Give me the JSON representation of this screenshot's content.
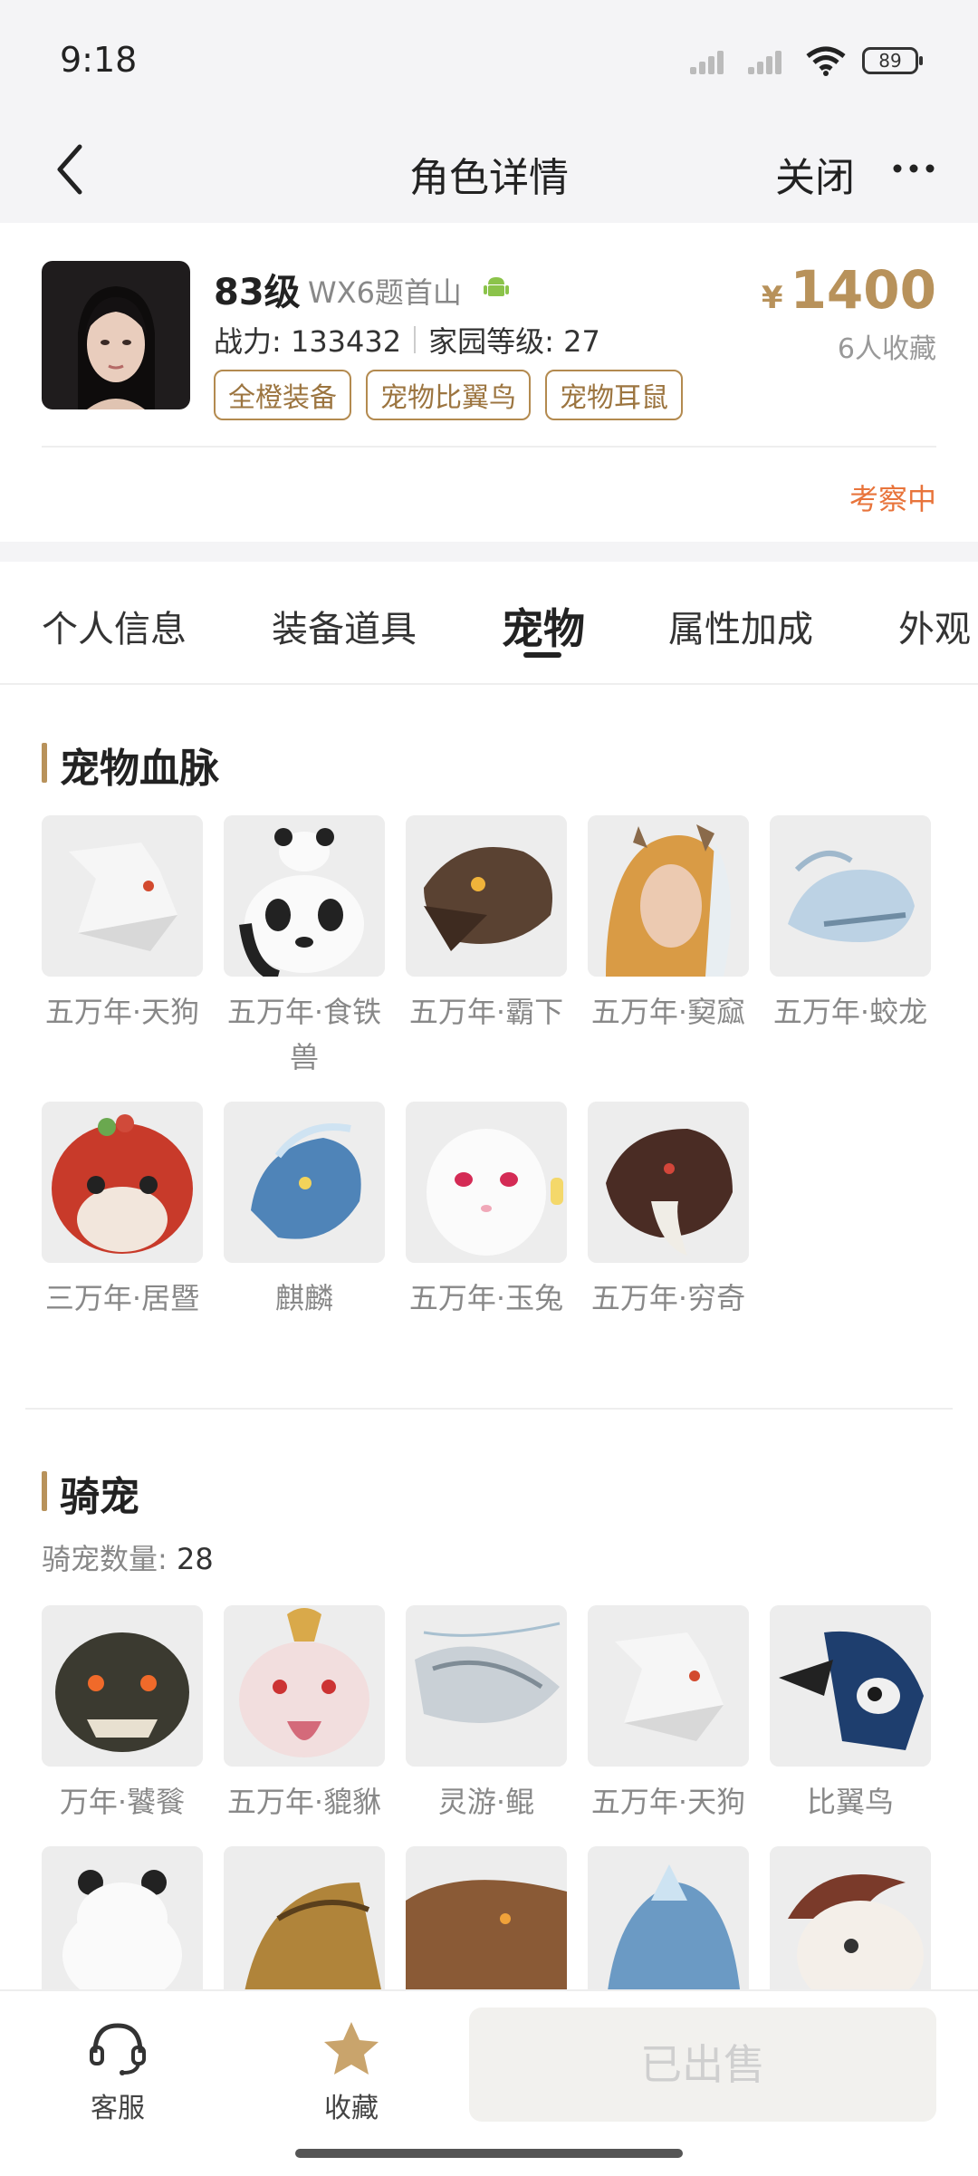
{
  "status_bar": {
    "time": "9:18",
    "battery": "89"
  },
  "nav": {
    "title": "角色详情",
    "close_label": "关闭"
  },
  "character": {
    "level": "83级",
    "server": "WX6题首山",
    "power": "战力: 133432",
    "home_level": "家园等级: 27",
    "tags": [
      "全橙装备",
      "宠物比翼鸟",
      "宠物耳鼠"
    ],
    "price_currency": "¥",
    "price": "1400",
    "favorites": "6人收藏",
    "status": "考察中"
  },
  "tabs": [
    "个人信息",
    "装备道具",
    "宠物",
    "属性加成",
    "外观"
  ],
  "active_tab": "宠物",
  "pet_bloodline": {
    "title": "宠物血脉",
    "items": [
      {
        "name": "五万年·天狗",
        "icon": "white-wolf-icon"
      },
      {
        "name": "五万年·食铁兽",
        "icon": "panda-icon"
      },
      {
        "name": "五万年·霸下",
        "icon": "dragon-turtle-icon"
      },
      {
        "name": "五万年·窫窳",
        "icon": "horned-beast-icon"
      },
      {
        "name": "五万年·蛟龙",
        "icon": "ice-dragon-icon"
      },
      {
        "name": "三万年·居暨",
        "icon": "red-fox-icon"
      },
      {
        "name": "麒麟",
        "icon": "qilin-icon"
      },
      {
        "name": "五万年·玉兔",
        "icon": "jade-rabbit-icon"
      },
      {
        "name": "五万年·穷奇",
        "icon": "tiger-beast-icon"
      }
    ]
  },
  "mounts": {
    "title": "骑宠",
    "count_label": "骑宠数量:",
    "count": "28",
    "items": [
      {
        "name": "万年·饕餮",
        "icon": "taotie-icon"
      },
      {
        "name": "五万年·貔貅",
        "icon": "pixiu-icon"
      },
      {
        "name": "灵游·鲲",
        "icon": "kun-fish-icon"
      },
      {
        "name": "五万年·天狗",
        "icon": "white-wolf-icon"
      },
      {
        "name": "比翼鸟",
        "icon": "twin-bird-icon"
      },
      {
        "name": "",
        "icon": "panda-icon"
      },
      {
        "name": "",
        "icon": "golden-beast-icon"
      },
      {
        "name": "",
        "icon": "lion-icon"
      },
      {
        "name": "",
        "icon": "blue-beast-icon"
      },
      {
        "name": "",
        "icon": "monkey-icon"
      }
    ]
  },
  "bottom": {
    "service_label": "客服",
    "favorite_label": "收藏",
    "sold_label": "已出售"
  },
  "colors": {
    "accent": "#b8925b",
    "status": "#e8743b",
    "tag_border": "#b38a4f"
  }
}
